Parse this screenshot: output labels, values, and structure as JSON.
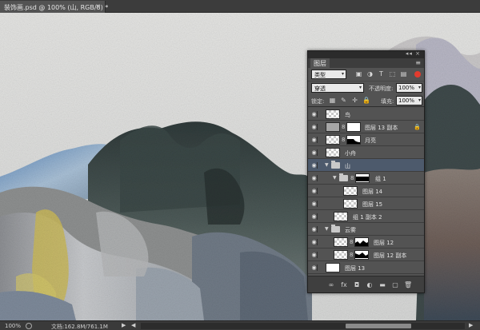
{
  "document": {
    "tab_title": "装饰画.psd @ 100% (山, RGB/8) *",
    "close_glyph": "×"
  },
  "statusbar": {
    "zoom": "100%",
    "doc_info": "文档:162.8M/761.1M",
    "arrow": "▶",
    "scroll_left": "◀",
    "scroll_right": "▶"
  },
  "layers_panel": {
    "tab_label": "图层",
    "strip_controls": "◂◂ ×",
    "menu_glyph": "≡",
    "filter_kind": "类型",
    "blend_mode": "穿透",
    "opacity_label": "不透明度:",
    "opacity_value": "100%",
    "lock_label": "锁定:",
    "fill_label": "填充:",
    "fill_value": "100%",
    "layers": [
      {
        "name": "鸟",
        "kind": "pixel",
        "indent": 0,
        "selected": false
      },
      {
        "name": "图层 13 副本",
        "kind": "masked-gray",
        "indent": 0,
        "selected": false,
        "locked": true
      },
      {
        "name": "月亮",
        "kind": "masked",
        "indent": 0,
        "selected": false
      },
      {
        "name": "小舟",
        "kind": "pixel",
        "indent": 0,
        "selected": false
      },
      {
        "name": "山",
        "kind": "group",
        "indent": 0,
        "selected": true,
        "expanded": true
      },
      {
        "name": "组 1",
        "kind": "group-masked",
        "indent": 1,
        "selected": false,
        "expanded": true
      },
      {
        "name": "图层 14",
        "kind": "pixel",
        "indent": 2,
        "selected": false
      },
      {
        "name": "图层 15",
        "kind": "pixel",
        "indent": 2,
        "selected": false
      },
      {
        "name": "组 1 副本 2",
        "kind": "pixel",
        "indent": 1,
        "selected": false
      },
      {
        "name": "云雾",
        "kind": "group",
        "indent": 0,
        "selected": false,
        "expanded": true
      },
      {
        "name": "图层 12",
        "kind": "masked",
        "indent": 1,
        "selected": false
      },
      {
        "name": "图层 12 副本",
        "kind": "masked",
        "indent": 1,
        "selected": false
      },
      {
        "name": "图层 13",
        "kind": "white",
        "indent": 0,
        "selected": false
      }
    ],
    "bottom_icons": [
      "link-icon",
      "fx-icon",
      "mask-icon",
      "adjustment-icon",
      "folder-icon",
      "new-layer-icon",
      "trash-icon"
    ],
    "bottom_glyphs": [
      "∞",
      "fx",
      "◘",
      "◐",
      "▬",
      "▢",
      "🗑"
    ]
  },
  "colors": {
    "ui_bg": "#535353",
    "selection": "#4d5a6c",
    "filter_toggle": "#e23b2e"
  }
}
